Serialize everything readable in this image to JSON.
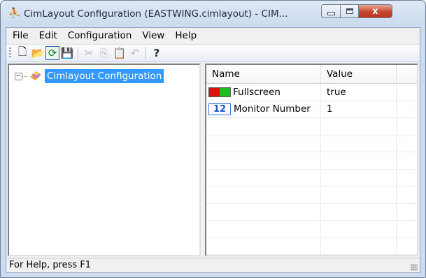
{
  "window": {
    "title": "CimLayout Configuration (EASTWING.cimlayout) - CIM...",
    "app_icon": "people-icon",
    "close_glyph": "x"
  },
  "menu": [
    "File",
    "Edit",
    "Configuration",
    "View",
    "Help"
  ],
  "toolbar": {
    "buttons": [
      {
        "name": "new-document-icon",
        "glyph": "🗋",
        "enabled": true
      },
      {
        "name": "open-folder-icon",
        "glyph": "📂",
        "enabled": false
      },
      {
        "name": "refresh-icon",
        "glyph": "⟳",
        "enabled": true
      },
      {
        "name": "save-icon",
        "glyph": "💾",
        "enabled": true
      },
      {
        "name": "cut-icon",
        "glyph": "✂",
        "enabled": false
      },
      {
        "name": "copy-icon",
        "glyph": "⎘",
        "enabled": false
      },
      {
        "name": "paste-icon",
        "glyph": "📋",
        "enabled": false
      },
      {
        "name": "undo-icon",
        "glyph": "↶",
        "enabled": false
      },
      {
        "name": "help-icon",
        "glyph": "?",
        "enabled": true
      }
    ]
  },
  "tree": {
    "root_label": "Cimlayout Configuration",
    "expander": "−"
  },
  "list": {
    "columns": [
      "Name",
      "Value"
    ],
    "rows": [
      {
        "name": "Fullscreen",
        "value": "true",
        "icon": "boolean-icon"
      },
      {
        "name": "Monitor Number",
        "value": "1",
        "icon": "number-icon",
        "icon_text": "12"
      }
    ]
  },
  "status": {
    "text": "For Help, press F1"
  },
  "colors": {
    "selection": "#3399ff",
    "titlebar": "#cddcef",
    "close_button": "#c9462c"
  }
}
